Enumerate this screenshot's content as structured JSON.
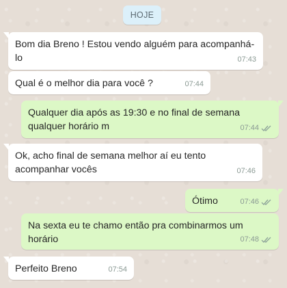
{
  "chat": {
    "date_label": "HOJE",
    "messages": [
      {
        "text": "Bom dia Breno ! Estou vendo alguém para acompanhá-lo",
        "time": "07:43"
      },
      {
        "text": "Qual é o melhor dia para você ?",
        "time": "07:44"
      },
      {
        "text": "Qualquer dia após as 19:30 e no final de semana qualquer horário m",
        "time": "07:44"
      },
      {
        "text": "Ok, acho final de semana melhor aí eu tento acompanhar vocês",
        "time": "07:46"
      },
      {
        "text": "Ótimo",
        "time": "07:46"
      },
      {
        "text": "Na sexta eu te chamo então pra combinarmos um horário",
        "time": "07:48"
      },
      {
        "text": "Perfeito Breno",
        "time": "07:54"
      }
    ]
  },
  "icons": {
    "read_receipt": "double-check-icon"
  }
}
